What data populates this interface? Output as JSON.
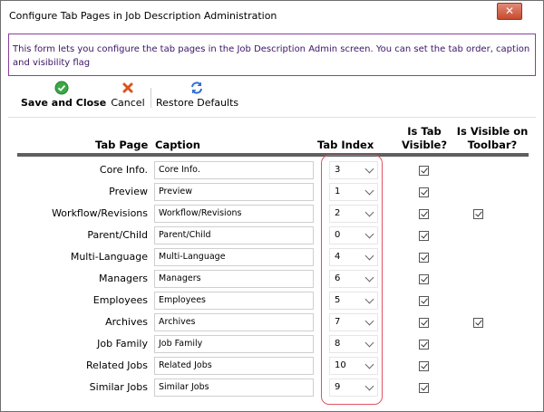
{
  "window": {
    "title": "Configure Tab Pages in Job Description Administration",
    "close_glyph": "✕"
  },
  "info": {
    "text": "This form lets you configure the tab pages in the Job Description Admin screen. You can set the tab order, caption and visibility flag"
  },
  "toolbar": {
    "save_label": "Save and Close",
    "cancel_label": "Cancel",
    "restore_label": "Restore Defaults",
    "save_icon": "check-circle-icon",
    "cancel_icon": "x-icon",
    "restore_icon": "refresh-icon"
  },
  "columns": {
    "tab_page": "Tab Page",
    "caption": "Caption",
    "tab_index": "Tab Index",
    "is_tab_visible": "Is Tab Visible?",
    "is_visible_toolbar": "Is Visible on Toolbar?"
  },
  "rows": [
    {
      "tab_page": "Core Info.",
      "caption": "Core Info.",
      "tab_index": "3",
      "tab_visible": true,
      "toolbar_visible": false
    },
    {
      "tab_page": "Preview",
      "caption": "Preview",
      "tab_index": "1",
      "tab_visible": true,
      "toolbar_visible": false
    },
    {
      "tab_page": "Workflow/Revisions",
      "caption": "Workflow/Revisions",
      "tab_index": "2",
      "tab_visible": true,
      "toolbar_visible": true
    },
    {
      "tab_page": "Parent/Child",
      "caption": "Parent/Child",
      "tab_index": "0",
      "tab_visible": true,
      "toolbar_visible": false
    },
    {
      "tab_page": "Multi-Language",
      "caption": "Multi-Language",
      "tab_index": "4",
      "tab_visible": true,
      "toolbar_visible": false
    },
    {
      "tab_page": "Managers",
      "caption": "Managers",
      "tab_index": "6",
      "tab_visible": true,
      "toolbar_visible": false
    },
    {
      "tab_page": "Employees",
      "caption": "Employees",
      "tab_index": "5",
      "tab_visible": true,
      "toolbar_visible": false
    },
    {
      "tab_page": "Archives",
      "caption": "Archives",
      "tab_index": "7",
      "tab_visible": true,
      "toolbar_visible": true
    },
    {
      "tab_page": "Job Family",
      "caption": "Job Family",
      "tab_index": "8",
      "tab_visible": true,
      "toolbar_visible": false
    },
    {
      "tab_page": "Related Jobs",
      "caption": "Related Jobs",
      "tab_index": "10",
      "tab_visible": true,
      "toolbar_visible": false
    },
    {
      "tab_page": "Similar Jobs",
      "caption": "Similar Jobs",
      "tab_index": "9",
      "tab_visible": true,
      "toolbar_visible": false
    }
  ],
  "colors": {
    "info_border": "#8b3ea0",
    "info_text": "#3b1466",
    "highlight": "#e05560",
    "save_green": "#3aa845",
    "cancel_orange": "#d9551f",
    "restore_blue": "#2f6fd0"
  }
}
